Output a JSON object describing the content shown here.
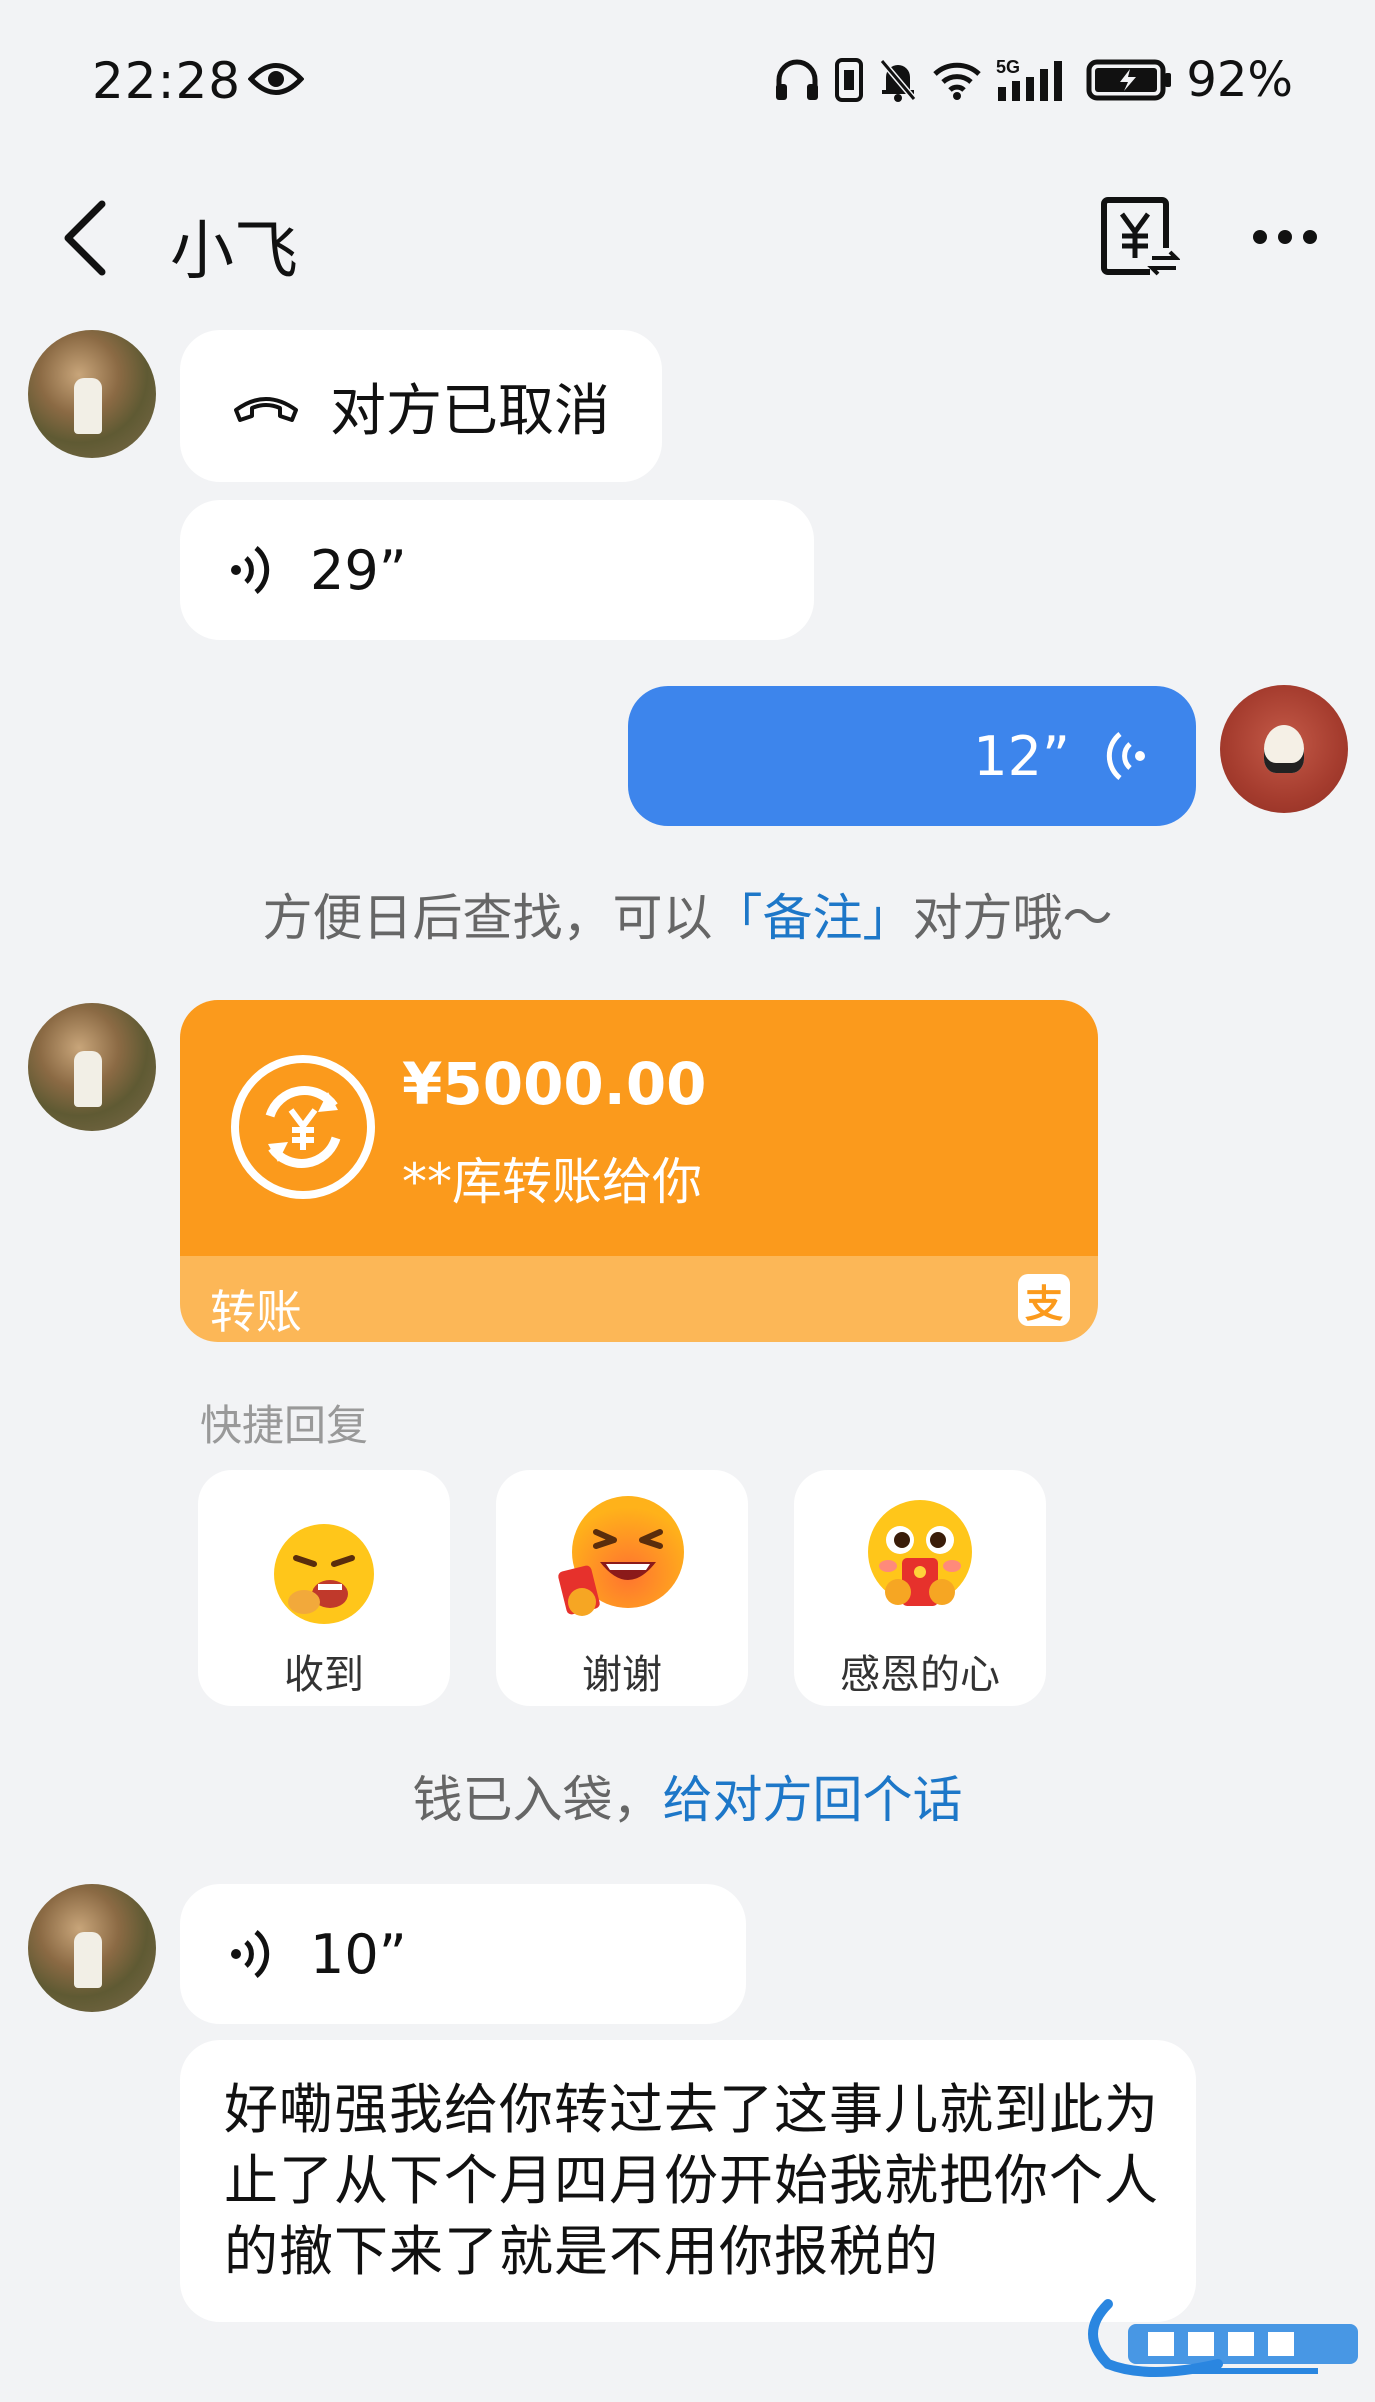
{
  "status_bar": {
    "time": "22:28",
    "battery": "92%",
    "network": "5G"
  },
  "header": {
    "title": "小飞",
    "back_icon": "chevron-left-icon",
    "yen_icon": "yen-transfer-icon",
    "more_icon": "more-dots-icon"
  },
  "messages": {
    "call": {
      "text": "对方已取消",
      "icon": "hangup-phone-icon"
    },
    "voice1": {
      "duration": "29”"
    },
    "voice_out": {
      "duration": "12”"
    },
    "hint1": {
      "prefix": "方便日后查找，可以",
      "link": "「备注」",
      "suffix": "对方哦～"
    },
    "transfer": {
      "amount": "¥5000.00",
      "desc": "**库转账给你",
      "label": "转账",
      "app_icon": "支"
    },
    "quick_reply": {
      "title": "快捷回复",
      "items": [
        {
          "label": "收到"
        },
        {
          "label": "谢谢"
        },
        {
          "label": "感恩的心"
        }
      ]
    },
    "hint2": {
      "prefix": "钱已入袋，",
      "link": "给对方回个话"
    },
    "voice2": {
      "duration": "10”"
    },
    "text": "好嘞强我给你转过去了这事儿就到此为止了从下个月四月份开始我就把你个人的撤下来了就是不用你报税的"
  },
  "colors": {
    "accent": "#3d85ec",
    "transfer": "#fb9a1c",
    "link": "#1d77c8"
  }
}
